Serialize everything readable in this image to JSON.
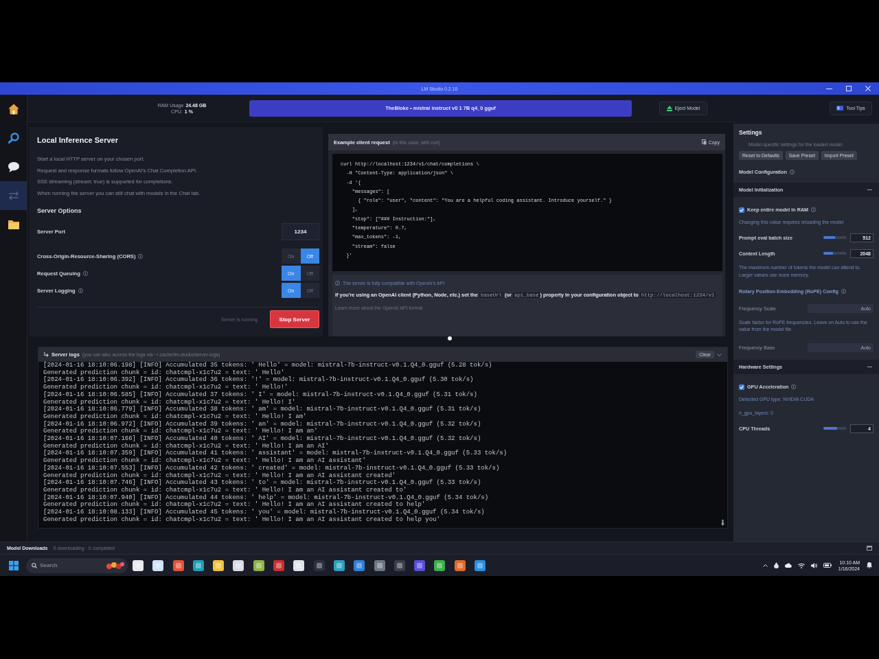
{
  "window": {
    "title": "LM Studio 0.2.10"
  },
  "nav": [
    {
      "kind": "home",
      "selected": false
    },
    {
      "kind": "search",
      "selected": false
    },
    {
      "kind": "chat",
      "selected": false
    },
    {
      "kind": "server",
      "selected": true
    },
    {
      "kind": "folder",
      "selected": false
    }
  ],
  "top_bar": {
    "ram_label": "RAM Usage",
    "ram_value": "24.48 GB",
    "cpu_label": "CPU:",
    "cpu_value": "1 %",
    "model": "TheBloke • mistral instruct v0 1 7B q4_0 gguf",
    "eject_button": "Eject Model",
    "tips_button": "Tool Tips"
  },
  "server": {
    "title": "Local Inference Server",
    "description": [
      "Start a local HTTP server on your chosen port.",
      "Request and response formats follow OpenAI's Chat Completion API.",
      "SSE streaming (stream: true) is supported for completions.",
      "When running the server you can still chat with models in the Chat tab."
    ],
    "options_title": "Server Options",
    "options": [
      {
        "kind": "field",
        "label": "Server Port",
        "value": "1234"
      },
      {
        "kind": "toggle",
        "label": "Cross-Origin-Resource-Sharing (CORS)",
        "segments": [
          {
            "label": "On",
            "selected": false
          },
          {
            "label": "Off",
            "selected": true
          }
        ]
      },
      {
        "kind": "toggle",
        "label": "Request Queuing",
        "segments": [
          {
            "label": "On",
            "selected": true
          },
          {
            "label": "Off",
            "selected": false
          }
        ]
      },
      {
        "kind": "toggle",
        "label": "Server Logging",
        "segments": [
          {
            "label": "On",
            "selected": true
          },
          {
            "label": "Off",
            "selected": false
          }
        ]
      }
    ],
    "status": "Server is running",
    "stop_button": "Stop Server"
  },
  "example": {
    "title": "Example client request",
    "subtitle": "(in this case, with curl)",
    "copy_button": "Copy",
    "code": [
      "curl http://localhost:1234/v1/chat/completions \\",
      "  -H \"Content-Type: application/json\" \\",
      "  -d '{",
      "    \"messages\": [",
      "      { \"role\": \"user\", \"content\": \"You are a helpful coding assistant. Introduce yourself.\" }",
      "    ],",
      "    \"stop\": [\"### Instruction:\"],",
      "    \"temperature\": 0.7,",
      "    \"max_tokens\": -1,",
      "    \"stream\": false",
      "  }'"
    ],
    "info": "The server is fully compatible with OpenAI's API",
    "paragraph": [
      {
        "kind": "text",
        "text": "If you're using an OpenAI client (Python, Node, etc.) set the "
      },
      {
        "kind": "code",
        "text": "baseUrl"
      },
      {
        "kind": "text",
        "text": " (or "
      },
      {
        "kind": "code",
        "text": "api_base"
      },
      {
        "kind": "text",
        "text": ") property in your configuration object to "
      },
      {
        "kind": "code",
        "text": "http://localhost:1234/v1"
      }
    ],
    "footer": "Learn more about the OpenAI API format"
  },
  "logs": {
    "title": "Server logs",
    "subtitle": "(you can also access the logs via ~/.cache/lm-studio/server-logs)",
    "clear_button": "Clear",
    "lines": [
      "[2024-01-16 18:10:06.198] [INFO] Accumulated 35 tokens: ' Hello' = model: mistral-7b-instruct-v0.1.Q4_0.gguf (5.28 tok/s)",
      "Generated prediction chunk = id: chatcmpl-x1c7u2 = text: ' Hello'",
      "[2024-01-16 18:10:06.392] [INFO] Accumulated 36 tokens: '!' = model: mistral-7b-instruct-v0.1.Q4_0.gguf (5.30 tok/s)",
      "Generated prediction chunk = id: chatcmpl-x1c7u2 = text: ' Hello!'",
      "[2024-01-16 18:10:06.585] [INFO] Accumulated 37 tokens: ' I' = model: mistral-7b-instruct-v0.1.Q4_0.gguf (5.31 tok/s)",
      "Generated prediction chunk = id: chatcmpl-x1c7u2 = text: ' Hello! I'",
      "[2024-01-16 18:10:06.779] [INFO] Accumulated 38 tokens: ' am' = model: mistral-7b-instruct-v0.1.Q4_0.gguf (5.31 tok/s)",
      "Generated prediction chunk = id: chatcmpl-x1c7u2 = text: ' Hello! I am'",
      "[2024-01-16 18:10:06.972] [INFO] Accumulated 39 tokens: ' an' = model: mistral-7b-instruct-v0.1.Q4_0.gguf (5.32 tok/s)",
      "Generated prediction chunk = id: chatcmpl-x1c7u2 = text: ' Hello! I am an'",
      "[2024-01-16 18:10:07.166] [INFO] Accumulated 40 tokens: ' AI' = model: mistral-7b-instruct-v0.1.Q4_0.gguf (5.32 tok/s)",
      "Generated prediction chunk = id: chatcmpl-x1c7u2 = text: ' Hello! I am an AI'",
      "[2024-01-16 18:10:07.359] [INFO] Accumulated 41 tokens: ' assistant' = model: mistral-7b-instruct-v0.1.Q4_0.gguf (5.33 tok/s)",
      "Generated prediction chunk = id: chatcmpl-x1c7u2 = text: ' Hello! I am an AI assistant'",
      "[2024-01-16 18:10:07.553] [INFO] Accumulated 42 tokens: ' created' = model: mistral-7b-instruct-v0.1.Q4_0.gguf (5.33 tok/s)",
      "Generated prediction chunk = id: chatcmpl-x1c7u2 = text: ' Hello! I am an AI assistant created'",
      "[2024-01-16 18:10:07.746] [INFO] Accumulated 43 tokens: ' to' = model: mistral-7b-instruct-v0.1.Q4_0.gguf (5.33 tok/s)",
      "Generated prediction chunk = id: chatcmpl-x1c7u2 = text: ' Hello! I am an AI assistant created to'",
      "[2024-01-16 18:10:07.940] [INFO] Accumulated 44 tokens: ' help' = model: mistral-7b-instruct-v0.1.Q4_0.gguf (5.34 tok/s)",
      "Generated prediction chunk = id: chatcmpl-x1c7u2 = text: ' Hello! I am an AI assistant created to help'",
      "[2024-01-16 18:10:08.133] [INFO] Accumulated 45 tokens: ' you' = model: mistral-7b-instruct-v0.1.Q4_0.gguf (5.34 tok/s)",
      "Generated prediction chunk = id: chatcmpl-x1c7u2 = text: ' Hello! I am an AI assistant created to help you'"
    ]
  },
  "settings": {
    "title": "Settings",
    "subtitle": "Model-specific settings for the loaded model",
    "buttons": [
      "Reset to Defaults",
      "Save Preset",
      "Import Preset"
    ],
    "items": [
      {
        "kind": "group",
        "label": "Model Configuration"
      },
      {
        "kind": "section",
        "label": "Model Initialization",
        "expanded": true
      },
      {
        "kind": "check",
        "label": "Keep entire model in RAM",
        "checked": true
      },
      {
        "kind": "note",
        "text": "Changing this value requires reloading the model"
      },
      {
        "kind": "number",
        "label": "Prompt eval batch size",
        "level": 0.5,
        "value": "512"
      },
      {
        "kind": "number",
        "label": "Context Length",
        "level": 0.4,
        "value": "2048"
      },
      {
        "kind": "note",
        "text": "The maximum number of tokens the model can attend to. Larger values use more memory."
      },
      {
        "kind": "group",
        "label": "Rotary Position Embedding (RoPE) Config"
      },
      {
        "kind": "text_field",
        "label": "Frequency Scale",
        "value": "Auto"
      },
      {
        "kind": "note",
        "text": "Scale factor for RoPE frequencies. Leave on Auto to use the value from the model file."
      },
      {
        "kind": "text_field",
        "label": "Frequency Base",
        "value": "Auto"
      },
      {
        "kind": "section",
        "label": "Hardware Settings",
        "expanded": true
      },
      {
        "kind": "check",
        "label": "GPU Acceleration",
        "checked": true
      },
      {
        "kind": "note",
        "text": "Detected GPU type: NVIDIA CUDA"
      },
      {
        "kind": "note",
        "text": "n_gpu_layers: 0"
      },
      {
        "kind": "number",
        "label": "CPU Threads",
        "level": 0.6,
        "value": "4"
      }
    ]
  },
  "status_bar": {
    "title": "Model Downloads",
    "detail": "0 downloading · 0 completed"
  },
  "taskbar": {
    "search_placeholder": "Search",
    "time": "10:10 AM",
    "date": "1/16/2024"
  }
}
